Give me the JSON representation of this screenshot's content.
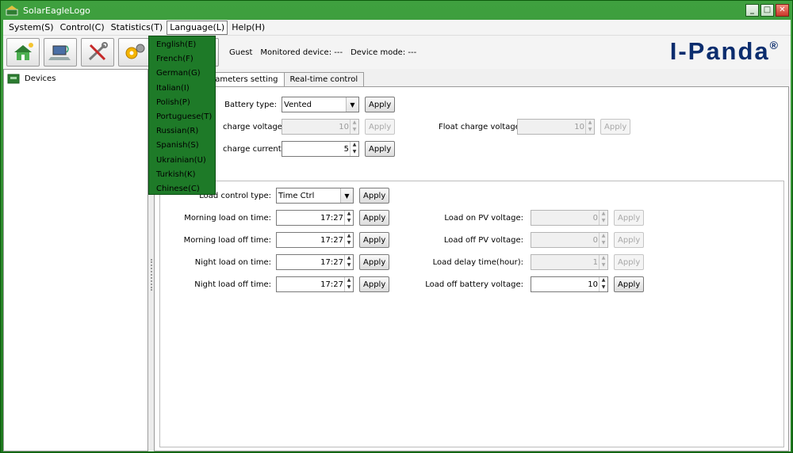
{
  "window": {
    "title": "SolarEagleLogo"
  },
  "menu": [
    {
      "label": "System(S)"
    },
    {
      "label": "Control(C)"
    },
    {
      "label": "Statistics(T)"
    },
    {
      "label": "Language(L)"
    },
    {
      "label": "Help(H)"
    }
  ],
  "language_menu": [
    "English(E)",
    "French(F)",
    "German(G)",
    "Italian(I)",
    "Polish(P)",
    "Portuguese(T)",
    "Russian(R)",
    "Spanish(S)",
    "Ukrainian(U)",
    "Turkish(K)",
    "Chinese(C)"
  ],
  "toolbar": {
    "user": "Guest",
    "monitored_device": "Monitored device:  ---",
    "device_mode": "Device mode:  ---"
  },
  "brand": {
    "name": "I-Panda",
    "mark": "®"
  },
  "tree": {
    "root": "Devices"
  },
  "tabs": [
    {
      "label": "Parameters setting"
    },
    {
      "label": "Real-time control"
    }
  ],
  "tab_visible_label": "arameters setting",
  "battery": {
    "type_label": "Battery type:",
    "type_value": "Vented",
    "charge_voltage_label": "charge voltage:",
    "charge_voltage_value": "10",
    "float_voltage_label": "Float charge voltage:",
    "float_voltage_value": "10",
    "charge_current_label": "charge current:",
    "charge_current_value": "5"
  },
  "load": {
    "control_type_label": "Load control type:",
    "control_type_value": "Time Ctrl",
    "morning_on_label": "Morning load on time:",
    "morning_on_value": "17:27",
    "morning_off_label": "Morning load off time:",
    "morning_off_value": "17:27",
    "night_on_label": "Night load on time:",
    "night_on_value": "17:27",
    "night_off_label": "Night load off time:",
    "night_off_value": "17:27",
    "pv_on_label": "Load on PV voltage:",
    "pv_on_value": "0",
    "pv_off_label": "Load off PV voltage:",
    "pv_off_value": "0",
    "delay_label": "Load delay time(hour):",
    "delay_value": "1",
    "battery_off_label": "Load off battery voltage:",
    "battery_off_value": "10"
  },
  "apply_label": "Apply"
}
